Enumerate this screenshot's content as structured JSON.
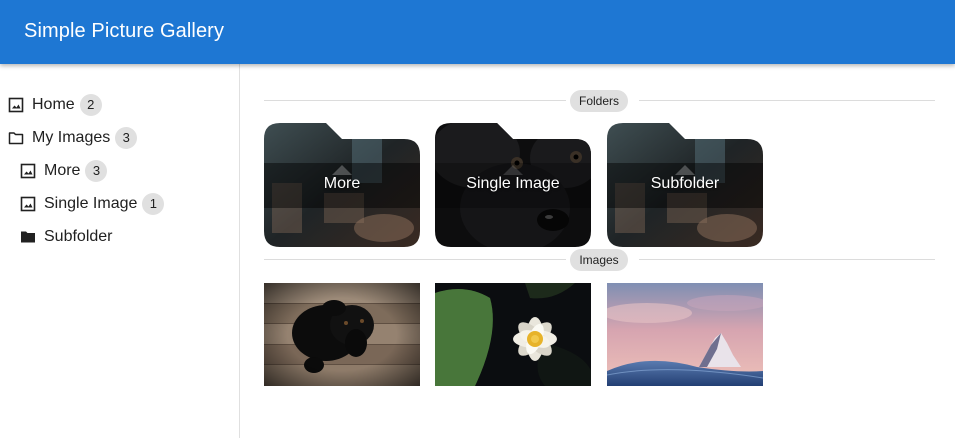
{
  "appbar": {
    "title": "Simple Picture Gallery"
  },
  "sidebar": {
    "items": [
      {
        "label": "Home",
        "count": "2",
        "icon": "image-icon"
      },
      {
        "label": "My Images",
        "count": "3",
        "icon": "folder-outline-icon"
      },
      {
        "label": "More",
        "count": "3",
        "icon": "image-icon"
      },
      {
        "label": "Single Image",
        "count": "1",
        "icon": "image-icon"
      },
      {
        "label": "Subfolder",
        "icon": "folder-filled-icon"
      }
    ]
  },
  "main": {
    "folders_heading": "Folders",
    "images_heading": "Images",
    "folders": [
      {
        "label": "More"
      },
      {
        "label": "Single Image"
      },
      {
        "label": "Subfolder"
      }
    ],
    "images": [
      {
        "subject": "black puppy on wooden planks"
      },
      {
        "subject": "white water lily on lily pad"
      },
      {
        "subject": "snowy mountain peak at dusk"
      }
    ]
  },
  "colors": {
    "appbar": "#1e77d3",
    "chip": "#e0e0e0",
    "divider": "#dcdcdc"
  }
}
